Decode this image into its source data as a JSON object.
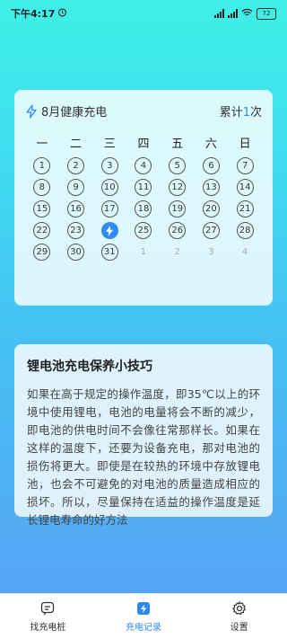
{
  "status_bar": {
    "time": "下午4:17",
    "battery": "72"
  },
  "calendar": {
    "title": "8月健康充电",
    "total_prefix": "累计",
    "total_count": "1",
    "total_suffix": "次",
    "weekdays": [
      "一",
      "二",
      "三",
      "四",
      "五",
      "六",
      "日"
    ],
    "rows": [
      [
        "1",
        "2",
        "3",
        "4",
        "5",
        "6",
        "7"
      ],
      [
        "8",
        "9",
        "10",
        "11",
        "12",
        "13",
        "14"
      ],
      [
        "15",
        "16",
        "17",
        "18",
        "19",
        "20",
        "21"
      ],
      [
        "22",
        "23",
        "",
        "25",
        "26",
        "27",
        "28"
      ],
      [
        "29",
        "30",
        "31",
        "1",
        "2",
        "3",
        "4"
      ]
    ],
    "charged_day_label": "24"
  },
  "tips": {
    "title": "锂电池充电保养小技巧",
    "body": "如果在高于规定的操作温度，即35℃以上的环境中使用锂电，电池的电量将会不断的减少，即电池的供电时间不会像往常那样长。如果在这样的温度下，还要为设备充电，那对电池的损伤将更大。即使是在较热的环境中存放锂电池，也会不可避免的对电池的质量造成相应的损坏。所以，尽量保持在适益的操作温度是延长锂电寿命的好方法"
  },
  "nav": {
    "find_label": "找充电桩",
    "records_label": "充电记录",
    "settings_label": "设置"
  },
  "colors": {
    "accent": "#2f8af5"
  }
}
